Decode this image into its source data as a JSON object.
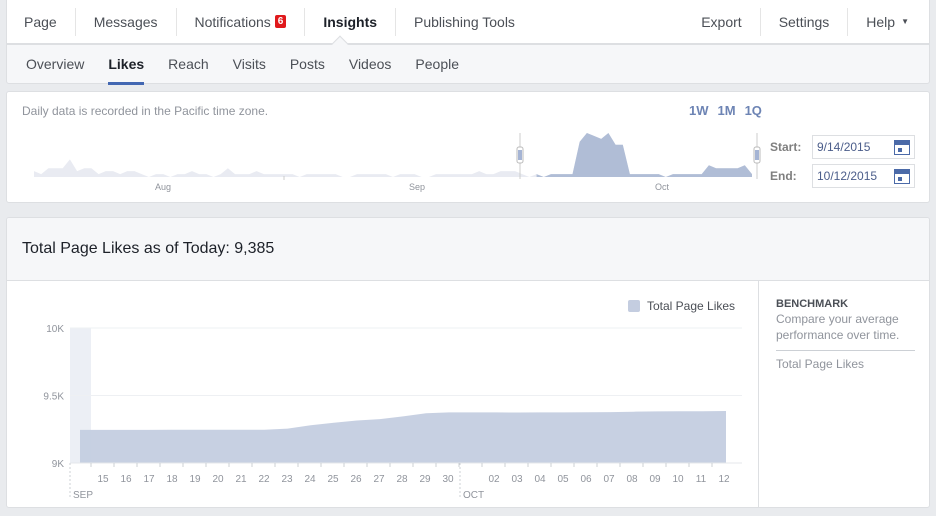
{
  "top_nav": {
    "items": [
      {
        "label": "Page"
      },
      {
        "label": "Messages"
      },
      {
        "label": "Notifications",
        "badge": "6"
      },
      {
        "label": "Insights",
        "active": true
      },
      {
        "label": "Publishing Tools"
      }
    ],
    "right_items": [
      {
        "label": "Export"
      },
      {
        "label": "Settings"
      },
      {
        "label": "Help",
        "icon": "caret-down-icon",
        "glyph": "▼"
      }
    ]
  },
  "sub_nav": {
    "tabs": [
      {
        "label": "Overview"
      },
      {
        "label": "Likes",
        "active": true
      },
      {
        "label": "Reach"
      },
      {
        "label": "Visits"
      },
      {
        "label": "Posts"
      },
      {
        "label": "Videos"
      },
      {
        "label": "People"
      }
    ]
  },
  "range_panel": {
    "note": "Daily data is recorded in the Pacific time zone.",
    "presets": [
      "1W",
      "1M",
      "1Q"
    ],
    "start_label": "Start:",
    "start_value": "9/14/2015",
    "end_label": "End:",
    "end_value": "10/12/2015",
    "month_labels": [
      "Aug",
      "Sep",
      "Oct"
    ],
    "overview_series": [
      2,
      1,
      3,
      3,
      3,
      6,
      2,
      3,
      3,
      1,
      2,
      2,
      1,
      2,
      2,
      1,
      0,
      1,
      1,
      0,
      1,
      1,
      2,
      1,
      1,
      0,
      1,
      3,
      1,
      1,
      1,
      2,
      1,
      1,
      1,
      1,
      1,
      0,
      1,
      1,
      1,
      1,
      1,
      0,
      0,
      1,
      1,
      1,
      1,
      1,
      0,
      1,
      1,
      1,
      0,
      0,
      1,
      1,
      1,
      1,
      1,
      1,
      2,
      1,
      1,
      2,
      2,
      2,
      1,
      0,
      1,
      0,
      1,
      1,
      1,
      1,
      12,
      15,
      14,
      13,
      15,
      11,
      11,
      1,
      1,
      1,
      1,
      1,
      0,
      1,
      1,
      1,
      1,
      1,
      4,
      3,
      3,
      3,
      3,
      4,
      1
    ],
    "selected_range": {
      "start_index": 70,
      "end_index": 100
    }
  },
  "likes_panel": {
    "title": "Total Page Likes as of Today: 9,385",
    "legend_label": "Total Page Likes",
    "benchmark": {
      "heading": "BENCHMARK",
      "description": "Compare your average performance over time.",
      "metric": "Total Page Likes"
    }
  },
  "colors": {
    "area_fill": "#c4cde0",
    "brand_blue": "#4267b2",
    "badge_red": "#e0191c"
  },
  "chart_data": {
    "type": "area",
    "title": "Total Page Likes",
    "xlabel": "",
    "ylabel": "",
    "ylim": [
      9000,
      10000
    ],
    "y_ticks": [
      "9K",
      "9.5K",
      "10K"
    ],
    "x_tick_labels": [
      "15",
      "16",
      "17",
      "18",
      "19",
      "20",
      "21",
      "22",
      "23",
      "24",
      "25",
      "26",
      "27",
      "28",
      "29",
      "30",
      "",
      "02",
      "03",
      "04",
      "05",
      "06",
      "07",
      "08",
      "09",
      "10",
      "11",
      "12"
    ],
    "month_labels": [
      {
        "label": "SEP",
        "at_index": 0
      },
      {
        "label": "OCT",
        "at_index": 17
      }
    ],
    "x": [
      "09-14",
      "09-15",
      "09-16",
      "09-17",
      "09-18",
      "09-19",
      "09-20",
      "09-21",
      "09-22",
      "09-23",
      "09-24",
      "09-25",
      "09-26",
      "09-27",
      "09-28",
      "09-29",
      "09-30",
      "10-01",
      "10-02",
      "10-03",
      "10-04",
      "10-05",
      "10-06",
      "10-07",
      "10-08",
      "10-09",
      "10-10",
      "10-11",
      "10-12"
    ],
    "series": [
      {
        "name": "Total Page Likes",
        "values": [
          9245,
          9245,
          9245,
          9245,
          9246,
          9246,
          9246,
          9246,
          9246,
          9255,
          9280,
          9298,
          9315,
          9325,
          9345,
          9368,
          9375,
          9375,
          9375,
          9374,
          9375,
          9375,
          9376,
          9377,
          9380,
          9382,
          9383,
          9384,
          9385
        ]
      }
    ],
    "highlighted_range": {
      "start": "09-13",
      "end": "09-14"
    },
    "grid": true,
    "legend": "top-right"
  }
}
